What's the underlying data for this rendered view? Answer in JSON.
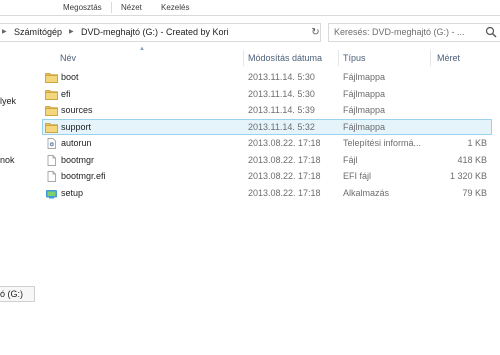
{
  "ribbon": {
    "tabs": [
      {
        "label": "Megosztás"
      },
      {
        "label": "Nézet"
      },
      {
        "label": "Kezelés"
      }
    ]
  },
  "address": {
    "crumbs": [
      {
        "label": "Számítógép"
      },
      {
        "label": "DVD-meghajtó (G:) - Created by Kori"
      }
    ]
  },
  "search": {
    "placeholder": "Keresés: DVD-meghajtó (G:) - ..."
  },
  "nav": {
    "items": [
      {
        "label": "lyek"
      },
      {
        "label": "nok"
      }
    ],
    "drive_label": "ó (G:)"
  },
  "columns": {
    "name": "Név",
    "date": "Módosítás dátuma",
    "type": "Típus",
    "size": "Méret"
  },
  "files": [
    {
      "name": "boot",
      "date": "2013.11.14. 5:30",
      "type": "Fájlmappa",
      "size": "",
      "icon": "folder-icon",
      "selected": false
    },
    {
      "name": "efi",
      "date": "2013.11.14. 5:30",
      "type": "Fájlmappa",
      "size": "",
      "icon": "folder-icon",
      "selected": false
    },
    {
      "name": "sources",
      "date": "2013.11.14. 5:39",
      "type": "Fájlmappa",
      "size": "",
      "icon": "folder-icon",
      "selected": false
    },
    {
      "name": "support",
      "date": "2013.11.14. 5:32",
      "type": "Fájlmappa",
      "size": "",
      "icon": "folder-icon",
      "selected": true
    },
    {
      "name": "autorun",
      "date": "2013.08.22. 17:18",
      "type": "Telepítési informá...",
      "size": "1 KB",
      "icon": "settings-file-icon",
      "selected": false
    },
    {
      "name": "bootmgr",
      "date": "2013.08.22. 17:18",
      "type": "Fájl",
      "size": "418 KB",
      "icon": "file-icon",
      "selected": false
    },
    {
      "name": "bootmgr.efi",
      "date": "2013.08.22. 17:18",
      "type": "EFI fájl",
      "size": "1 320 KB",
      "icon": "file-icon",
      "selected": false
    },
    {
      "name": "setup",
      "date": "2013.08.22. 17:18",
      "type": "Alkalmazás",
      "size": "79 KB",
      "icon": "setup-app-icon",
      "selected": false
    }
  ],
  "colors": {
    "selection_bg": "#e5f3fb",
    "selection_border": "#99d1ee",
    "folder": "#e8c15a",
    "header_text": "#4c607a"
  }
}
